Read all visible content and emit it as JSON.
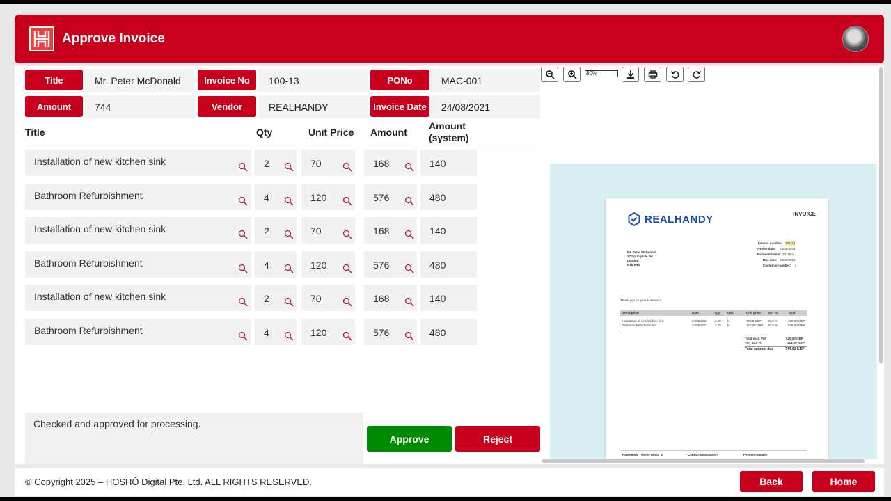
{
  "header": {
    "title": "Approve Invoice",
    "logo_icon": "hosho-logo",
    "avatar_icon": "user-avatar"
  },
  "fields": {
    "title_label": "Title",
    "title_value": "Mr. Peter McDonald",
    "invoice_no_label": "Invoice No",
    "invoice_no_value": "100-13",
    "pono_label": "PONo",
    "pono_value": "MAC-001",
    "amount_label": "Amount",
    "amount_value": "744",
    "vendor_label": "Vendor",
    "vendor_value": "REALHANDY",
    "invoice_date_label": "Invoice Date",
    "invoice_date_value": "24/08/2021"
  },
  "table": {
    "columns": [
      "Title",
      "Qty",
      "Unit Price",
      "Amount",
      "Amount (system)"
    ],
    "rows": [
      {
        "title": "Installation of new kitchen sink",
        "qty": "2",
        "unit_price": "70",
        "amount": "168",
        "amount_system": "140"
      },
      {
        "title": "Bathroom Refurbishment",
        "qty": "4",
        "unit_price": "120",
        "amount": "576",
        "amount_system": "480"
      },
      {
        "title": "Installation of new kitchen sink",
        "qty": "2",
        "unit_price": "70",
        "amount": "168",
        "amount_system": "140"
      },
      {
        "title": "Bathroom Refurbishment",
        "qty": "4",
        "unit_price": "120",
        "amount": "576",
        "amount_system": "480"
      },
      {
        "title": "Installation of new kitchen sink",
        "qty": "2",
        "unit_price": "70",
        "amount": "168",
        "amount_system": "140"
      },
      {
        "title": "Bathroom Refurbishment",
        "qty": "4",
        "unit_price": "120",
        "amount": "576",
        "amount_system": "480"
      }
    ]
  },
  "comments": {
    "value": "Checked and approved for processing."
  },
  "actions": {
    "approve": "Approve",
    "reject": "Reject"
  },
  "viewer": {
    "toolbar_icons": [
      "zoom-out-icon",
      "zoom-in-icon",
      "download-icon",
      "print-icon",
      "rotate-left-icon",
      "rotate-right-icon"
    ],
    "zoom_value": "80%",
    "document": {
      "brand": "REALHANDY",
      "heading": "INVOICE",
      "invoice_number_label": "Invoice number:",
      "invoice_number": "100-13",
      "invoice_date_label": "Invoice date:",
      "invoice_date": "24/08/2021",
      "payment_terms_label": "Payment terms:",
      "payment_terms": "30 days",
      "due_date_label": "Due date:",
      "due_date": "23/09/2021",
      "customer_number_label": "Customer number:",
      "customer_number": "2",
      "address": [
        "Mr. Peter McDonald",
        "17 Springdale Rd",
        "London",
        "N16 9NS"
      ],
      "thanks": "Thank you for your business!",
      "columns": [
        "Description",
        "Date",
        "Qty",
        "Unit",
        "Unit price",
        "VAT %",
        "Total"
      ],
      "lines": [
        [
          "Installation of new kitchen sink",
          "24/08/2021",
          "2.00",
          "h",
          "70.00 GBP",
          "20.0 %",
          "168.00 GBP"
        ],
        [
          "Bathroom Refurbishment",
          "24/08/2021",
          "4.00",
          "h",
          "120.00 GBP",
          "20.0 %",
          "576.00 GBP"
        ]
      ],
      "total_excl_label": "Total excl. VAT",
      "total_excl": "620.00 GBP",
      "vat_label": "VAT 20.0 %",
      "vat": "124.00 GBP",
      "total_due_label": "Total amount due",
      "total_due": "744.00 GBP",
      "footer": [
        "RealHandy - Home repair &",
        "Contact information",
        "Payment details"
      ]
    }
  },
  "footer": {
    "copyright": "© Copyright 2025 – HOSHŌ Digital Pte. Ltd. ALL RIGHTS RESERVED.",
    "back": "Back",
    "home": "Home"
  },
  "colors": {
    "brand_red": "#c8001e",
    "approve_green": "#008a00",
    "viewer_bg": "#d8f0f4",
    "doc_blue": "#1a4fa8"
  }
}
